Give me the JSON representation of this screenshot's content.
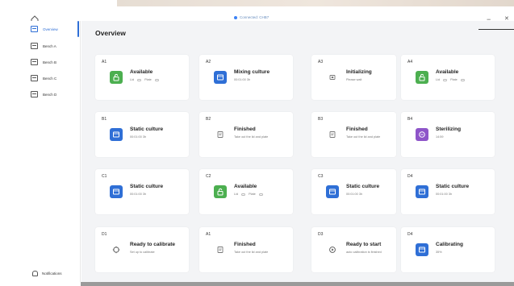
{
  "window": {
    "connection": "Connected: CHB7",
    "minimize": "−",
    "close": "✕"
  },
  "colors": {
    "green": "#4caf50",
    "blue": "#2f6fd6",
    "grey": "#e9e9e9",
    "purple": "#8e55c9"
  },
  "sidebar": {
    "items": [
      {
        "label": "Overview",
        "icon": "overview-icon"
      },
      {
        "label": "Bench A",
        "icon": "bench-icon"
      },
      {
        "label": "Bench B",
        "icon": "bench-icon"
      },
      {
        "label": "Bench C",
        "icon": "bench-icon"
      },
      {
        "label": "Bench D",
        "icon": "bench-icon"
      }
    ],
    "notifications": "Notifications"
  },
  "main": {
    "title": "Overview"
  },
  "cards": [
    {
      "id": "A1",
      "status": "Available",
      "sub": "Lid",
      "sub2": "Plate",
      "icon": "unlock-icon",
      "color": "green",
      "toggles": true
    },
    {
      "id": "A2",
      "status": "Mixing culture",
      "sub": "00:01:00 3h",
      "icon": "app-window-icon",
      "color": "blue"
    },
    {
      "id": "A3",
      "status": "Initializing",
      "sub": "Please wait",
      "icon": "chip-icon",
      "color": "grey"
    },
    {
      "id": "A4",
      "status": "Available",
      "sub": "Lid",
      "sub2": "Plate",
      "icon": "unlock-icon",
      "color": "green",
      "toggles": true
    },
    {
      "id": "B1",
      "status": "Static culture",
      "sub": "00:01:00 3h",
      "icon": "app-window-icon",
      "color": "blue"
    },
    {
      "id": "B2",
      "status": "Finished",
      "sub": "Take out the lid and plate",
      "icon": "document-icon",
      "color": "grey"
    },
    {
      "id": "B3",
      "status": "Finished",
      "sub": "Take out the lid and plate",
      "icon": "document-icon",
      "color": "grey"
    },
    {
      "id": "B4",
      "status": "Sterilizing",
      "sub": "14:59",
      "icon": "sterilize-icon",
      "color": "purple"
    },
    {
      "id": "C1",
      "status": "Static culture",
      "sub": "00:01:00 3h",
      "icon": "app-window-icon",
      "color": "blue"
    },
    {
      "id": "C2",
      "status": "Available",
      "sub": "Lid",
      "sub2": "Plate",
      "icon": "unlock-icon",
      "color": "green",
      "toggles": true
    },
    {
      "id": "C3",
      "status": "Static culture",
      "sub": "00:01:00 3h",
      "icon": "app-window-icon",
      "color": "blue"
    },
    {
      "id": "D4",
      "status": "Static culture",
      "sub": "00:01:00 3h",
      "icon": "app-window-icon",
      "color": "blue"
    },
    {
      "id": "D1",
      "status": "Ready to calibrate",
      "sub": "Set up to calibrate",
      "icon": "crosshair-icon",
      "color": "grey"
    },
    {
      "id": "A1",
      "status": "Finished",
      "sub": "Take out the lid and plate",
      "icon": "document-icon",
      "color": "grey"
    },
    {
      "id": "D3",
      "status": "Ready to start",
      "sub": "auto calibration is finished",
      "icon": "play-icon",
      "color": "grey"
    },
    {
      "id": "D4",
      "status": "Calibrating",
      "sub": "35%",
      "icon": "app-window-icon",
      "color": "blue"
    }
  ]
}
